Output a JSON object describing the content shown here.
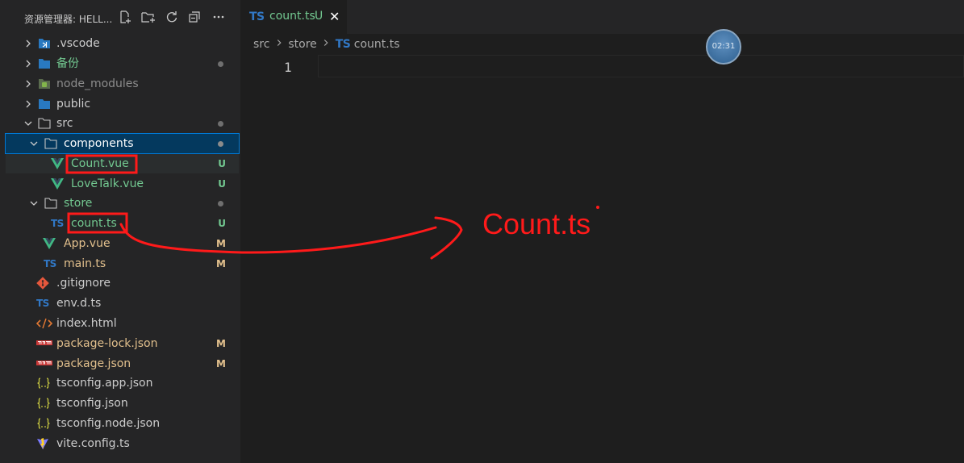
{
  "sidebar": {
    "title": "资源管理器: HELL...",
    "header_icons": [
      "new-file-icon",
      "new-folder-icon",
      "refresh-icon",
      "collapse-all-icon",
      "more-icon"
    ],
    "items": [
      {
        "label": ".vscode",
        "kind": "folder",
        "icon": "vscode-folder-icon",
        "expanded": false,
        "status": "",
        "color": "#cccccc"
      },
      {
        "label": "备份",
        "kind": "folder",
        "icon": "folder-icon",
        "expanded": false,
        "status": "dot",
        "color": "#73c991"
      },
      {
        "label": "node_modules",
        "kind": "folder",
        "icon": "node-folder-icon",
        "expanded": false,
        "status": "",
        "color": "#8c8c8c"
      },
      {
        "label": "public",
        "kind": "folder",
        "icon": "folder-icon",
        "expanded": false,
        "status": "",
        "color": "#cccccc"
      },
      {
        "label": "src",
        "kind": "folder",
        "icon": "folder-open-icon",
        "expanded": true,
        "status": "dot",
        "color": "#cccccc"
      },
      {
        "label": "components",
        "kind": "folder",
        "icon": "folder-open-icon",
        "expanded": true,
        "status": "dot",
        "color": "#ffffff"
      },
      {
        "label": "Count.vue",
        "kind": "file",
        "icon": "vue-icon",
        "status": "U",
        "color": "#73c991"
      },
      {
        "label": "LoveTalk.vue",
        "kind": "file",
        "icon": "vue-icon",
        "status": "U",
        "color": "#73c991"
      },
      {
        "label": "store",
        "kind": "folder",
        "icon": "folder-open-icon",
        "expanded": true,
        "status": "dot",
        "color": "#73c991"
      },
      {
        "label": "count.ts",
        "kind": "file",
        "icon": "ts-icon",
        "status": "U",
        "color": "#73c991"
      },
      {
        "label": "App.vue",
        "kind": "file",
        "icon": "vue-icon",
        "status": "M",
        "color": "#e2c08d"
      },
      {
        "label": "main.ts",
        "kind": "file",
        "icon": "ts-icon",
        "status": "M",
        "color": "#e2c08d"
      },
      {
        "label": ".gitignore",
        "kind": "file",
        "icon": "git-icon",
        "status": "",
        "color": "#cccccc"
      },
      {
        "label": "env.d.ts",
        "kind": "file",
        "icon": "ts-icon",
        "status": "",
        "color": "#cccccc"
      },
      {
        "label": "index.html",
        "kind": "file",
        "icon": "html-icon",
        "status": "",
        "color": "#cccccc"
      },
      {
        "label": "package-lock.json",
        "kind": "file",
        "icon": "npm-icon",
        "status": "M",
        "color": "#e2c08d"
      },
      {
        "label": "package.json",
        "kind": "file",
        "icon": "npm-icon",
        "status": "M",
        "color": "#e2c08d"
      },
      {
        "label": "tsconfig.app.json",
        "kind": "file",
        "icon": "json-icon",
        "status": "",
        "color": "#cccccc"
      },
      {
        "label": "tsconfig.json",
        "kind": "file",
        "icon": "json-icon",
        "status": "",
        "color": "#cccccc"
      },
      {
        "label": "tsconfig.node.json",
        "kind": "file",
        "icon": "json-icon",
        "status": "",
        "color": "#cccccc"
      },
      {
        "label": "vite.config.ts",
        "kind": "file",
        "icon": "vite-icon",
        "status": "",
        "color": "#cccccc"
      }
    ]
  },
  "editor": {
    "tab": {
      "icon_text": "TS",
      "label": "count.ts",
      "status": "U",
      "close": "✕"
    },
    "breadcrumb": {
      "part1": "src",
      "part2": "store",
      "icon_text": "TS",
      "part3": "count.ts"
    },
    "line_numbers": [
      "1"
    ]
  },
  "overlay": {
    "timer": "02:31",
    "annotation": "Count.ts"
  },
  "colors": {
    "untracked": "#73c991",
    "modified": "#e2c08d",
    "annotation": "#ff1a1a",
    "ts": "#3178c6",
    "vue": "#41b883"
  }
}
